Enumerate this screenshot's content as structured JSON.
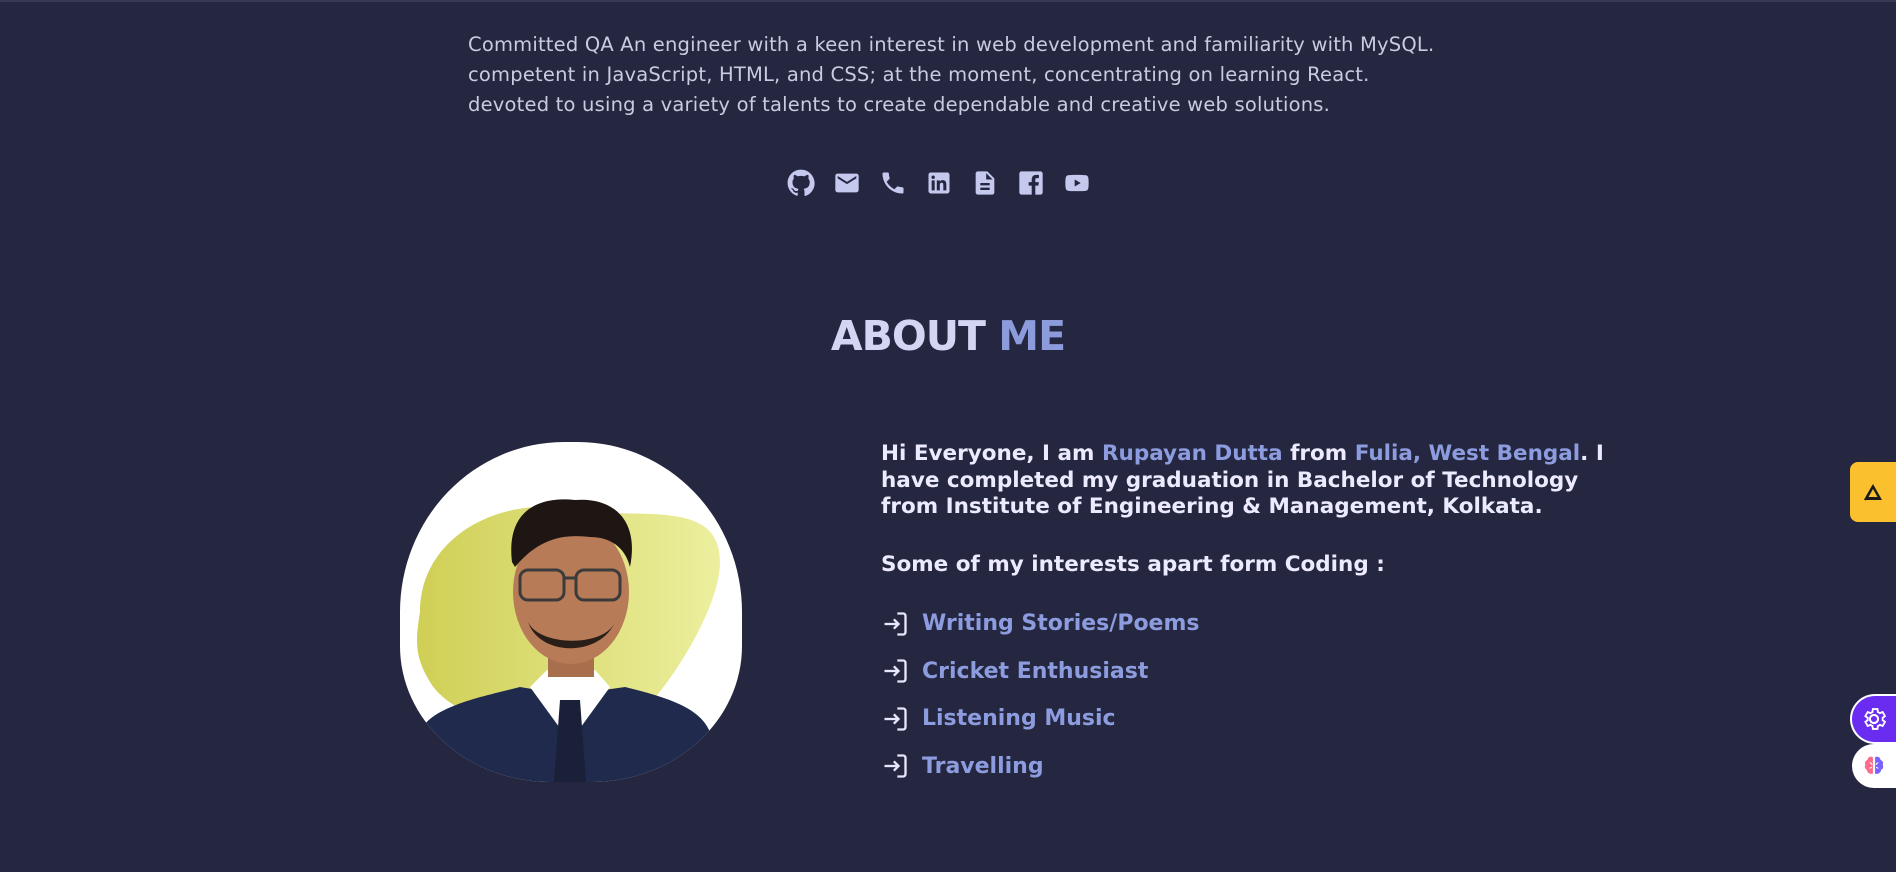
{
  "intro": {
    "lines": [
      "Committed QA An engineer with a keen interest in web development and familiarity with MySQL.",
      "competent in JavaScript, HTML, and CSS; at the moment, concentrating on learning React.",
      "devoted to using a variety of talents to create dependable and creative web solutions."
    ]
  },
  "socials": [
    {
      "icon": "github-icon"
    },
    {
      "icon": "mail-icon"
    },
    {
      "icon": "phone-icon"
    },
    {
      "icon": "linkedin-icon"
    },
    {
      "icon": "document-icon"
    },
    {
      "icon": "facebook-icon"
    },
    {
      "icon": "youtube-icon"
    }
  ],
  "about": {
    "title_part1": "ABOUT",
    "title_part2": "ME",
    "bio": {
      "intro": "Hi Everyone, I am ",
      "name": "Rupayan Dutta",
      "from": " from ",
      "location": "Fulia, West Bengal",
      "rest": ". I have completed my graduation in Bachelor of Technology from Institute of Engineering & Management, Kolkata."
    },
    "interests_title": "Some of my interests apart form Coding :",
    "interests": [
      "Writing Stories/Poems",
      "Cricket Enthusiast",
      "Listening Music",
      "Travelling"
    ]
  },
  "colors": {
    "background": "#252740",
    "accent": "#8c9cde",
    "widget_yellow": "#fbc02d",
    "widget_purple": "#6a2cf0"
  }
}
